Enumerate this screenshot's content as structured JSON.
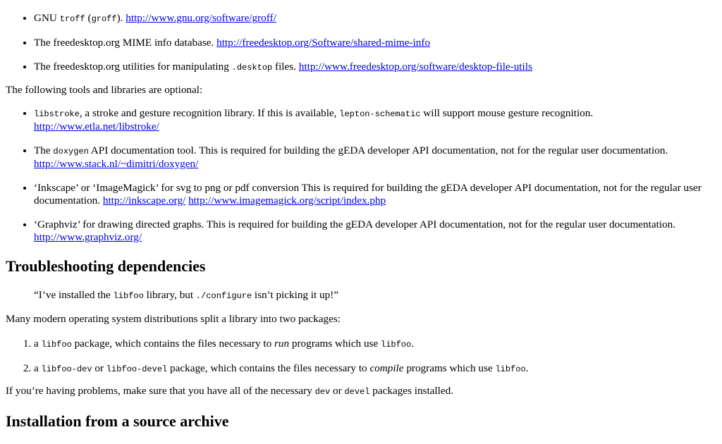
{
  "deps_required": [
    {
      "pre": "GNU ",
      "code": "troff",
      "mid": " (",
      "code2": "groff",
      "post": "). ",
      "link": "http://www.gnu.org/software/groff/"
    },
    {
      "pre": "The freedesktop.org MIME info database. ",
      "link": "http://freedesktop.org/Software/shared-mime-info"
    },
    {
      "pre": "The freedesktop.org utilities for manipulating ",
      "code": ".desktop",
      "post": " files. ",
      "link": "http://www.freedesktop.org/software/desktop-file-utils"
    }
  ],
  "optional_intro": "The following tools and libraries are optional:",
  "deps_optional": {
    "libstroke": {
      "code": "libstroke",
      "t1": ", a stroke and gesture recognition library. If this is available, ",
      "code2": "lepton-schematic",
      "t2": " will support mouse gesture recognition.",
      "link": "http://www.etla.net/libstroke/"
    },
    "doxygen": {
      "t0": "The ",
      "code": "doxygen",
      "t1": " API documentation tool. This is required for building the gEDA developer API documentation, not for the regular user documentation.",
      "link": "http://www.stack.nl/~dimitri/doxygen/"
    },
    "inkscape": {
      "t1": "‘Inkscape’ or ‘ImageMagick’ for svg to png or pdf conversion This is required for building the gEDA developer API documentation, not for the regular user documentation. ",
      "link": "http://inkscape.org/",
      "link2": "http://www.imagemagick.org/script/index.php"
    },
    "graphviz": {
      "t1": "‘Graphviz’ for drawing directed graphs. This is required for building the gEDA developer API documentation, not for the regular user documentation.",
      "link": "http://www.graphviz.org/"
    }
  },
  "troubleshooting": {
    "heading": "Troubleshooting dependencies",
    "quote": {
      "t0": "“I’ve installed the ",
      "code": "libfoo",
      "t1": " library, but ",
      "code2": "./configure",
      "t2": " isn’t picking it up!”"
    },
    "intro": "Many modern operating system distributions split a library into two packages:",
    "item1": {
      "t0": "a ",
      "code": "libfoo",
      "t1": " package, which contains the files necessary to ",
      "em": "run",
      "t2": " programs which use ",
      "code2": "libfoo",
      "t3": "."
    },
    "item2": {
      "t0": "a ",
      "code": "libfoo-dev",
      "t1": " or ",
      "code2": "libfoo-devel",
      "t2": " package, which contains the files necessary to ",
      "em": "compile",
      "t3": " programs which use ",
      "code3": "libfoo",
      "t4": "."
    },
    "closing": {
      "t0": "If you’re having problems, make sure that you have all of the necessary ",
      "code": "dev",
      "t1": " or ",
      "code2": "devel",
      "t2": " packages installed."
    }
  },
  "install_heading": "Installation from a source archive"
}
